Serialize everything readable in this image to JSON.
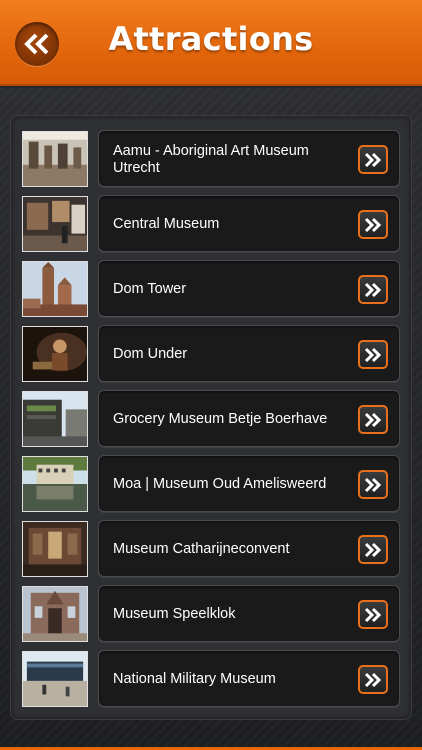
{
  "header": {
    "title": "Attractions",
    "back_icon": "double-chevron-left-icon",
    "color": "#e3660c"
  },
  "attractions": [
    {
      "label": "Aamu - Aboriginal Art Museum Utrecht",
      "thumb": "gallery-interior"
    },
    {
      "label": "Central Museum",
      "thumb": "museum-room"
    },
    {
      "label": "Dom Tower",
      "thumb": "tower-skyline"
    },
    {
      "label": "Dom Under",
      "thumb": "underground-visitor"
    },
    {
      "label": "Grocery Museum Betje Boerhave",
      "thumb": "street-building"
    },
    {
      "label": "Moa | Museum Oud Amelisweerd",
      "thumb": "manor-reflection"
    },
    {
      "label": "Museum Catharijneconvent",
      "thumb": "church-interior"
    },
    {
      "label": "Museum Speelklok",
      "thumb": "church-facade"
    },
    {
      "label": "National Military Museum",
      "thumb": "modern-building"
    }
  ],
  "row_action_icon": "double-chevron-right-icon"
}
